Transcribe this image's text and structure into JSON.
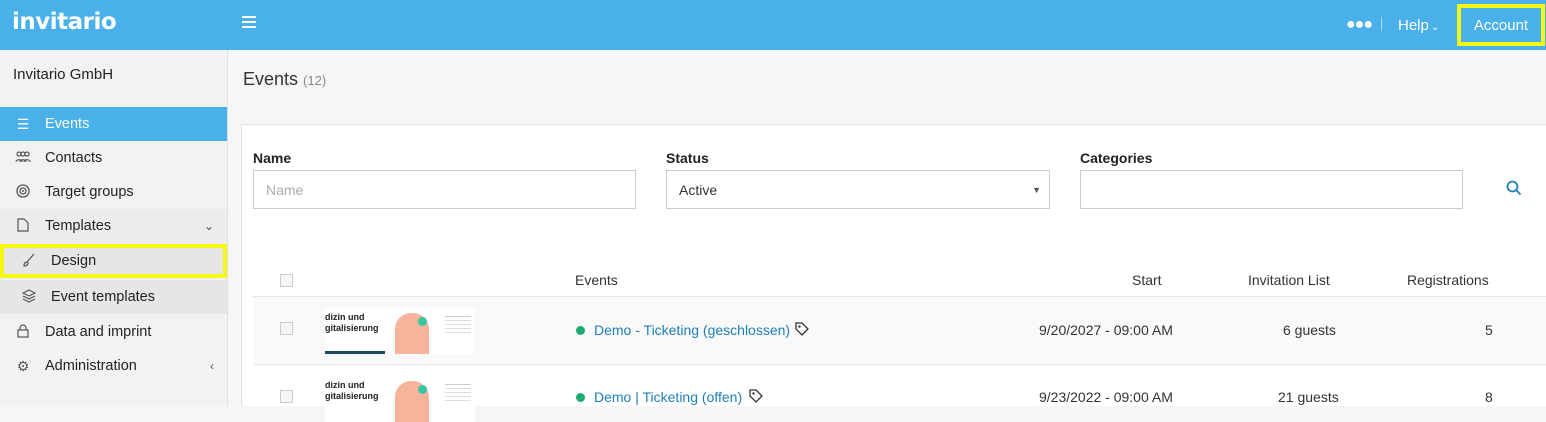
{
  "topbar": {
    "logo": "invitario",
    "help_label": "Help",
    "account_label": "Account",
    "accent_color": "#49b0ea",
    "highlight_color": "#f5f714"
  },
  "sidebar": {
    "org_name": "Invitario GmbH",
    "items": [
      {
        "label": "Events",
        "icon": "list-icon"
      },
      {
        "label": "Contacts",
        "icon": "people-icon"
      },
      {
        "label": "Target groups",
        "icon": "target-icon"
      },
      {
        "label": "Templates",
        "icon": "file-icon"
      },
      {
        "label": "Design",
        "icon": "brush-icon"
      },
      {
        "label": "Event templates",
        "icon": "layers-icon"
      },
      {
        "label": "Data and imprint",
        "icon": "lock-icon"
      },
      {
        "label": "Administration",
        "icon": "gear-icon"
      }
    ]
  },
  "main": {
    "title": "Events",
    "count": "(12)",
    "filters": {
      "name_label": "Name",
      "name_placeholder": "Name",
      "status_label": "Status",
      "status_value": "Active",
      "categories_label": "Categories"
    },
    "table": {
      "columns": [
        "Events",
        "Start",
        "Invitation List",
        "Registrations"
      ],
      "rows": [
        {
          "thumb_text": "dizin und\ngitalisierung",
          "name": "Demo - Ticketing (geschlossen)",
          "start": "9/20/2027 - 09:00 AM",
          "invitation": "6 guests",
          "registrations": "5"
        },
        {
          "thumb_text": "dizin und\ngitalisierung",
          "name": "Demo | Ticketing (offen)",
          "start": "9/23/2022 - 09:00 AM",
          "invitation": "21 guests",
          "registrations": "8"
        }
      ]
    }
  }
}
